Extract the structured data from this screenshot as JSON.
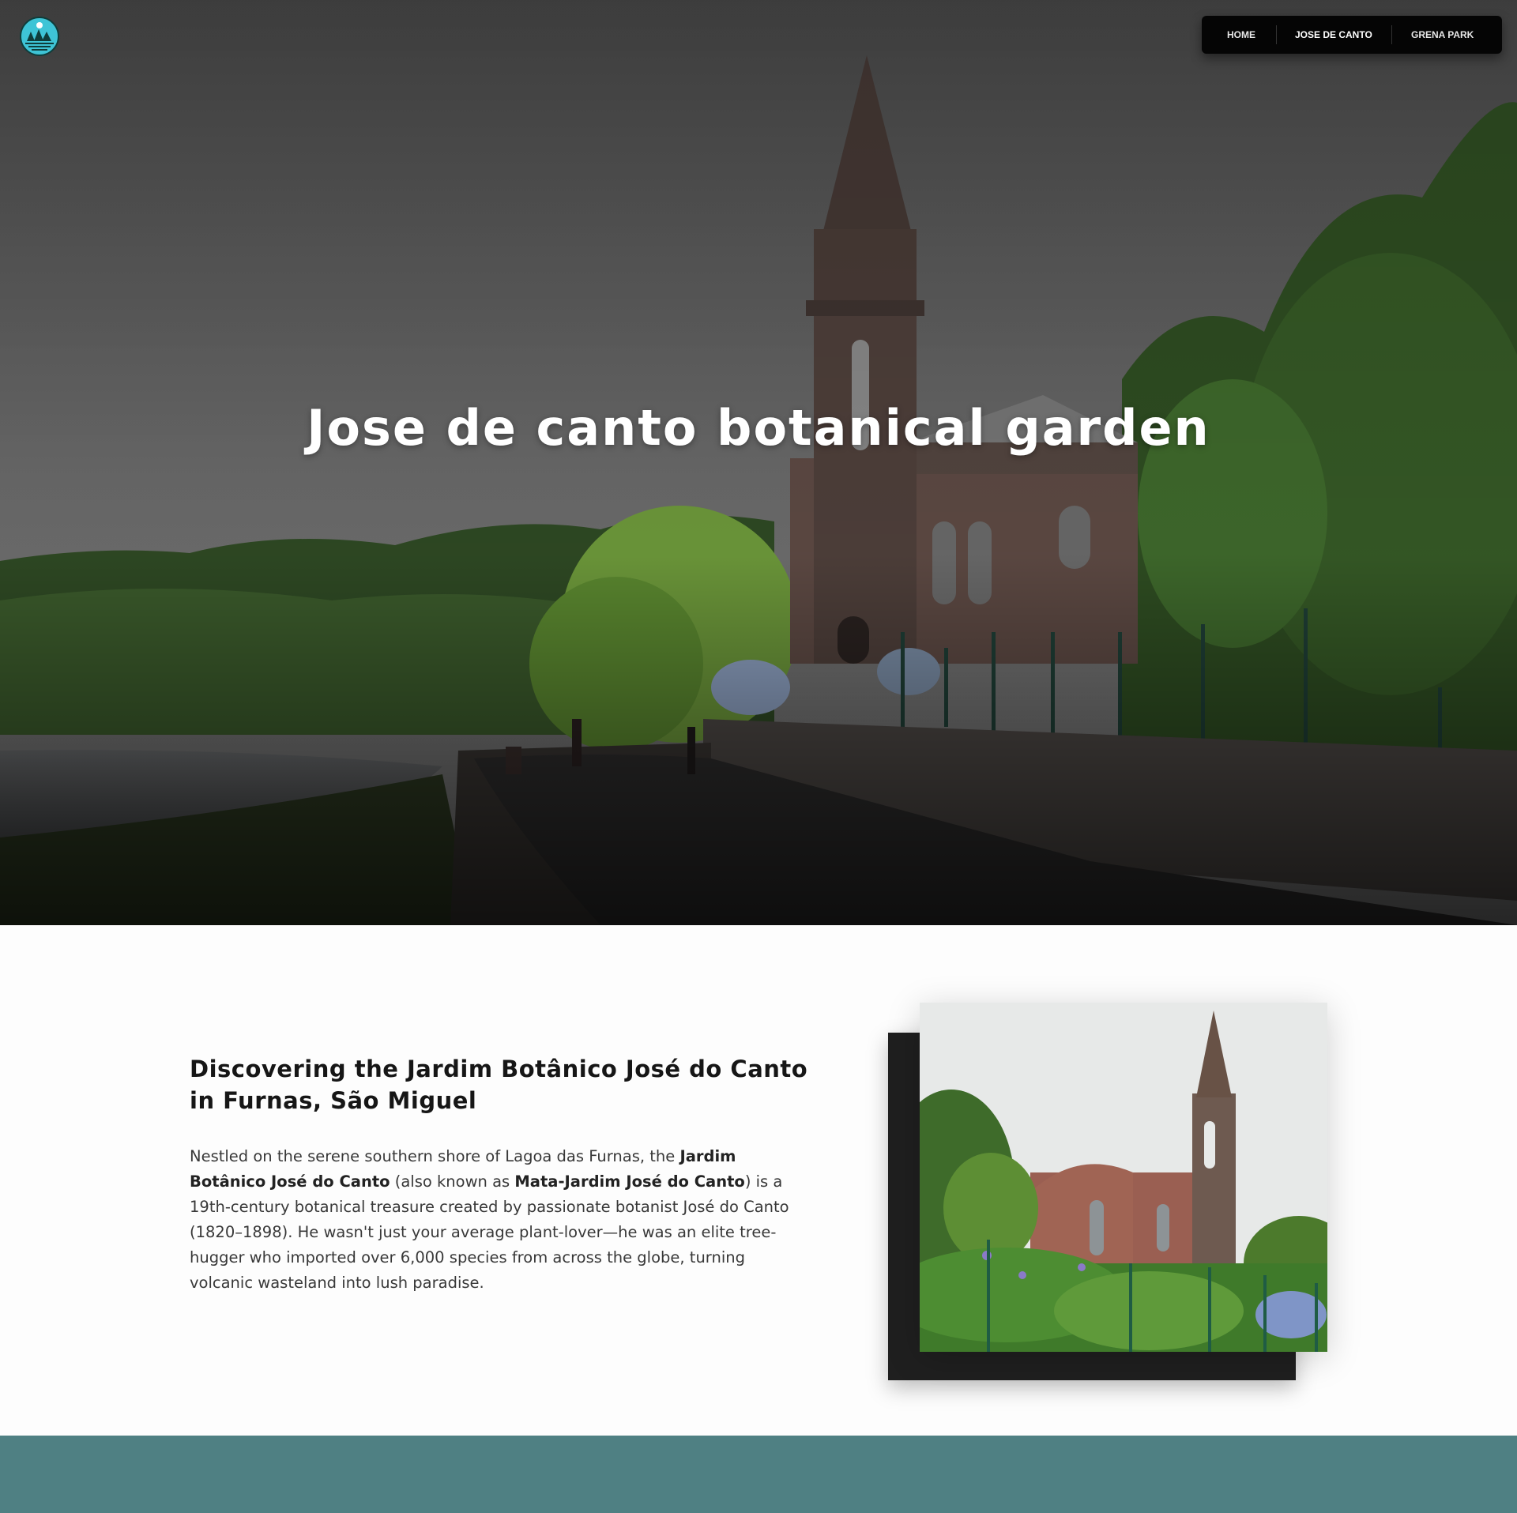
{
  "hero": {
    "title": "Jose de canto botanical garden"
  },
  "nav": {
    "items": [
      {
        "label": "HOME"
      },
      {
        "label": "JOSE DE CANTO"
      },
      {
        "label": "GRENA PARK"
      }
    ]
  },
  "section": {
    "heading": "Discovering the Jardim Botânico José do Canto in Furnas, São Miguel",
    "body": {
      "p1": "Nestled on the serene southern shore of Lagoa das Furnas, the ",
      "b1": "Jardim Botânico José do Canto",
      "p2": " (also known as ",
      "b2": "Mata-Jardim José do Canto",
      "p3": ") is a 19th-century botanical treasure created by passionate botanist José do Canto (1820–1898). He wasn't just your average plant-lover—he was an elite tree-hugger who imported over 6,000 species from across the globe, turning volcanic wasteland into lush paradise."
    }
  },
  "colors": {
    "nav_bg": "#050505",
    "band": "#4f8083",
    "logo_water": "#3ec4d6",
    "logo_trees": "#0f3d3b"
  },
  "icons": {
    "logo": "lake-forest-logo-icon"
  }
}
